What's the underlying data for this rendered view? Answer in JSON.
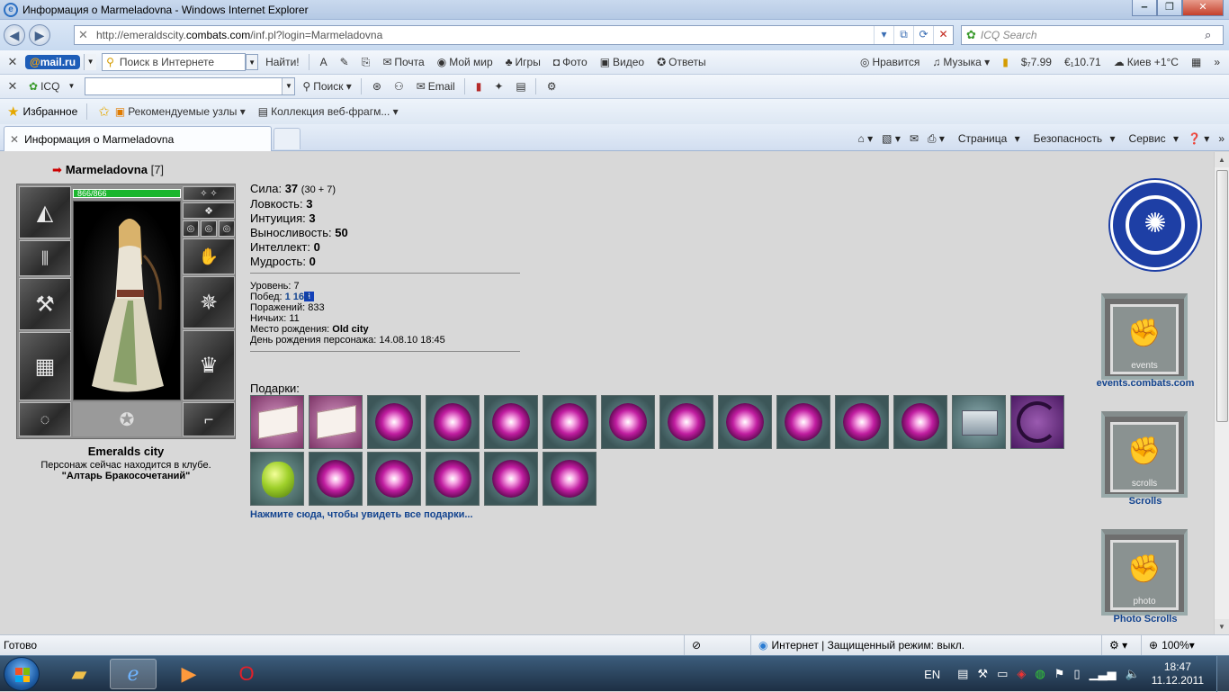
{
  "window": {
    "title": "Информация о Marmeladovna - Windows Internet Explorer",
    "min": "‒",
    "max": "❐",
    "close": "✕"
  },
  "nav": {
    "url_prefix": "http://emeraldscity.",
    "url_domain": "combats.com",
    "url_path": "/inf.pl?login=Marmeladovna",
    "search_placeholder": "ICQ Search"
  },
  "mailru_bar": {
    "logo_at": "@",
    "logo_mail": "mail",
    "logo_dot": ".ru",
    "search_placeholder": "Поиск в Интернете",
    "find_label": "Найти!",
    "items": [
      "Почта",
      "Мой мир",
      "Игры",
      "Фото",
      "Видео",
      "Ответы"
    ],
    "like": "Нравится",
    "music": "Музыка",
    "usd": "$₇7.99",
    "eur": "€₁10.71",
    "weather": "Киев +1°С"
  },
  "icq_bar": {
    "icq": "ICQ",
    "search": "Поиск",
    "email": "Email"
  },
  "favorites_bar": {
    "favorites": "Избранное",
    "recommended": "Рекомендуемые узлы",
    "gallery": "Коллекция веб-фрагм..."
  },
  "tab": {
    "title": "Информация о Marmeladovna"
  },
  "command_bar": {
    "page": "Страница",
    "safety": "Безопасность",
    "tools": "Сервис"
  },
  "character": {
    "name": "Marmeladovna",
    "level_tag": "[7]",
    "hp": "866/866",
    "hp_fraction": 1.0,
    "city": "Emeralds city",
    "location_line1": "Персонаж сейчас находится в клубе.",
    "location_line2": "\"Алтарь Бракосочетаний\""
  },
  "stats": {
    "strength_label": "Сила:",
    "strength": "37",
    "strength_extra": "(30 + 7)",
    "agility_label": "Ловкость:",
    "agility": "3",
    "intuition_label": "Интуиция:",
    "intuition": "3",
    "endurance_label": "Выносливость:",
    "endurance": "50",
    "intellect_label": "Интеллект:",
    "intellect": "0",
    "wisdom_label": "Мудрость:",
    "wisdom": "0"
  },
  "info": {
    "level_label": "Уровень:",
    "level": "7",
    "wins_label": "Побед:",
    "wins": "1 163",
    "losses_label": "Поражений:",
    "losses": "833",
    "draws_label": "Ничьих:",
    "draws": "11",
    "birthplace_label": "Место рождения:",
    "birthplace": "Old city",
    "birthday_label": "День рождения персонажа:",
    "birthday": "14.08.10 18:45"
  },
  "gifts": {
    "title": "Подарки:",
    "all_link": "Нажмите сюда, чтобы увидеть все подарки..."
  },
  "right": {
    "events_link": "events.combats.com",
    "events_banner": "events",
    "scrolls_link": "Scrolls",
    "scrolls_banner": "scrolls",
    "photo_link": "Photo Scrolls",
    "photo_banner": "photo"
  },
  "status": {
    "ready": "Готово",
    "zone": "Интернет | Защищенный режим: выкл.",
    "zoom": "100%"
  },
  "taskbar": {
    "lang": "EN",
    "time": "18:47",
    "date": "11.12.2011"
  },
  "colors": {
    "link": "#13448f",
    "hp_bar": "#1bb62e",
    "emblem": "#1e3fa5"
  }
}
